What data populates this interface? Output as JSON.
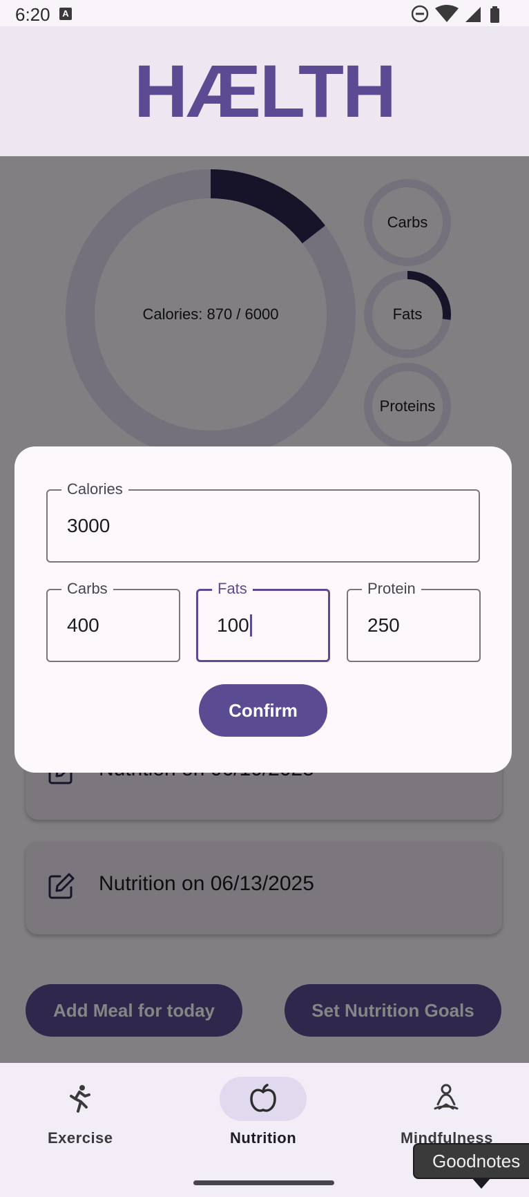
{
  "status_bar": {
    "time": "6:20",
    "a_badge": "A",
    "icons": [
      "dnd-icon",
      "wifi-icon",
      "signal-icon",
      "battery-icon"
    ]
  },
  "app": {
    "logo": "HÆLTH"
  },
  "summary": {
    "calories_label": "Calories: 870 / 6000",
    "calories_progress": 0.145,
    "carbs_label": "Carbs",
    "carbs_progress": 0.0,
    "fats_label": "Fats",
    "fats_progress": 0.27,
    "proteins_label": "Proteins",
    "proteins_progress": 0.0
  },
  "history": [
    {
      "label": "Nutrition on 06/10/2025"
    },
    {
      "label": "Nutrition on 06/13/2025"
    }
  ],
  "actions": {
    "add_meal": "Add Meal for today",
    "set_goals": "Set Nutrition Goals"
  },
  "dialog": {
    "calories": {
      "label": "Calories",
      "value": "3000"
    },
    "carbs": {
      "label": "Carbs",
      "value": "400"
    },
    "fats": {
      "label": "Fats",
      "value": "100"
    },
    "protein": {
      "label": "Protein",
      "value": "250"
    },
    "confirm": "Confirm"
  },
  "nav": {
    "items": [
      {
        "label": "Exercise",
        "icon": "running-person-icon"
      },
      {
        "label": "Nutrition",
        "icon": "apple-icon",
        "active": true
      },
      {
        "label": "Mindfulness",
        "icon": "meditation-icon"
      }
    ]
  },
  "tooltip": {
    "text": "Goodnotes"
  },
  "colors": {
    "primary": "#5a4b92",
    "ring_fill": "#2d2550",
    "ring_track": "#e0d9ee"
  }
}
